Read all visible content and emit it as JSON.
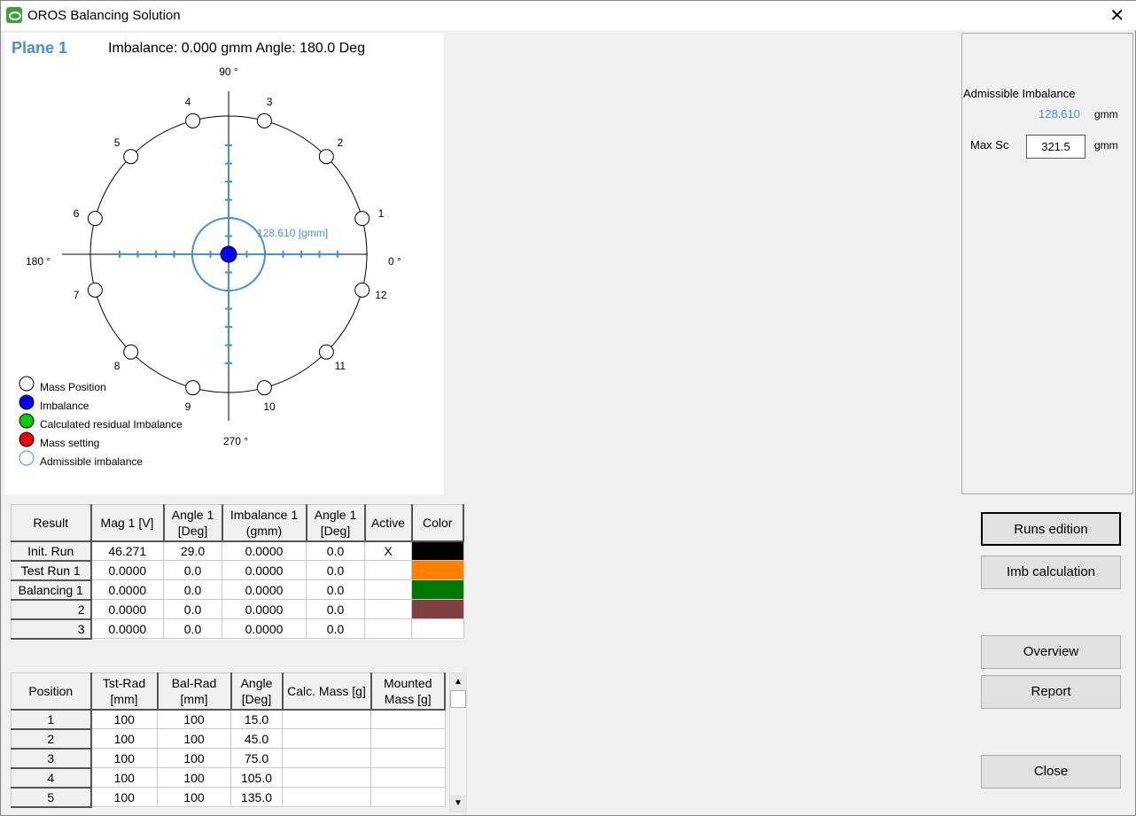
{
  "window": {
    "title": "OROS Balancing Solution",
    "close": "✕"
  },
  "plot": {
    "plane": "Plane 1",
    "imbalance_text": "Imbalance: 0.000 gmm Angle: 180.0 Deg",
    "axis_labels": {
      "a90": "90 °",
      "a0": "0 °",
      "a180": "180 °",
      "a270": "270 °"
    },
    "admissible_label": "128.610 [gmm]",
    "mass_positions": [
      "1",
      "2",
      "3",
      "4",
      "5",
      "6",
      "7",
      "8",
      "9",
      "10",
      "11",
      "12"
    ],
    "mass_angles": [
      15,
      45,
      75,
      105,
      135,
      165,
      195,
      225,
      255,
      285,
      315,
      345
    ],
    "imbalance_angle": 180,
    "imbalance_value": 0.0,
    "legend": [
      "Mass Position",
      "Imbalance",
      "Calculated residual Imbalance",
      "Mass setting",
      "Admissible imbalance"
    ],
    "colors": {
      "axis": "#4a90d0",
      "imbalance": "#0000ff",
      "residual": "#00cc00",
      "mass_setting": "#ee0000"
    }
  },
  "right_panel": {
    "admissible_label": "Admissible Imbalance",
    "admissible_value": "128.610",
    "unit": "gmm",
    "max_sc_label": "Max Sc",
    "max_sc_value": "321.5",
    "max_sc_unit": "gmm"
  },
  "results": {
    "headers": [
      "Result",
      "Mag 1  [V]",
      "Angle 1 [Deg]",
      "Imbalance 1 (gmm)",
      "Angle 1 [Deg]",
      "Active",
      "Color"
    ],
    "rows": [
      {
        "name": "Init. Run",
        "mag": "46.271",
        "angle": "29.0",
        "imb": "0.0000",
        "iangle": "0.0",
        "active": "X",
        "color": "#000000"
      },
      {
        "name": "Test Run 1",
        "mag": "0.0000",
        "angle": "0.0",
        "imb": "0.0000",
        "iangle": "0.0",
        "active": "",
        "color": "#ff8000"
      },
      {
        "name": "Balancing 1",
        "mag": "0.0000",
        "angle": "0.0",
        "imb": "0.0000",
        "iangle": "0.0",
        "active": "",
        "color": "#007800"
      },
      {
        "name": "2",
        "mag": "0.0000",
        "angle": "0.0",
        "imb": "0.0000",
        "iangle": "0.0",
        "active": "",
        "color": "#804040"
      },
      {
        "name": "3",
        "mag": "0.0000",
        "angle": "0.0",
        "imb": "0.0000",
        "iangle": "0.0",
        "active": "",
        "color": "#ffffff"
      }
    ]
  },
  "positions": {
    "headers": [
      "Position",
      "Tst-Rad [mm]",
      "Bal-Rad [mm]",
      "Angle [Deg]",
      "Calc. Mass [g]",
      "Mounted Mass  [g]"
    ],
    "rows": [
      {
        "pos": "1",
        "tst": "100",
        "bal": "100",
        "angle": "15.0",
        "calc": "",
        "mounted": ""
      },
      {
        "pos": "2",
        "tst": "100",
        "bal": "100",
        "angle": "45.0",
        "calc": "",
        "mounted": ""
      },
      {
        "pos": "3",
        "tst": "100",
        "bal": "100",
        "angle": "75.0",
        "calc": "",
        "mounted": ""
      },
      {
        "pos": "4",
        "tst": "100",
        "bal": "100",
        "angle": "105.0",
        "calc": "",
        "mounted": ""
      },
      {
        "pos": "5",
        "tst": "100",
        "bal": "100",
        "angle": "135.0",
        "calc": "",
        "mounted": ""
      }
    ]
  },
  "buttons": {
    "runs": "Runs edition",
    "imb": "Imb calculation",
    "overview": "Overview",
    "report": "Report",
    "close": "Close"
  }
}
